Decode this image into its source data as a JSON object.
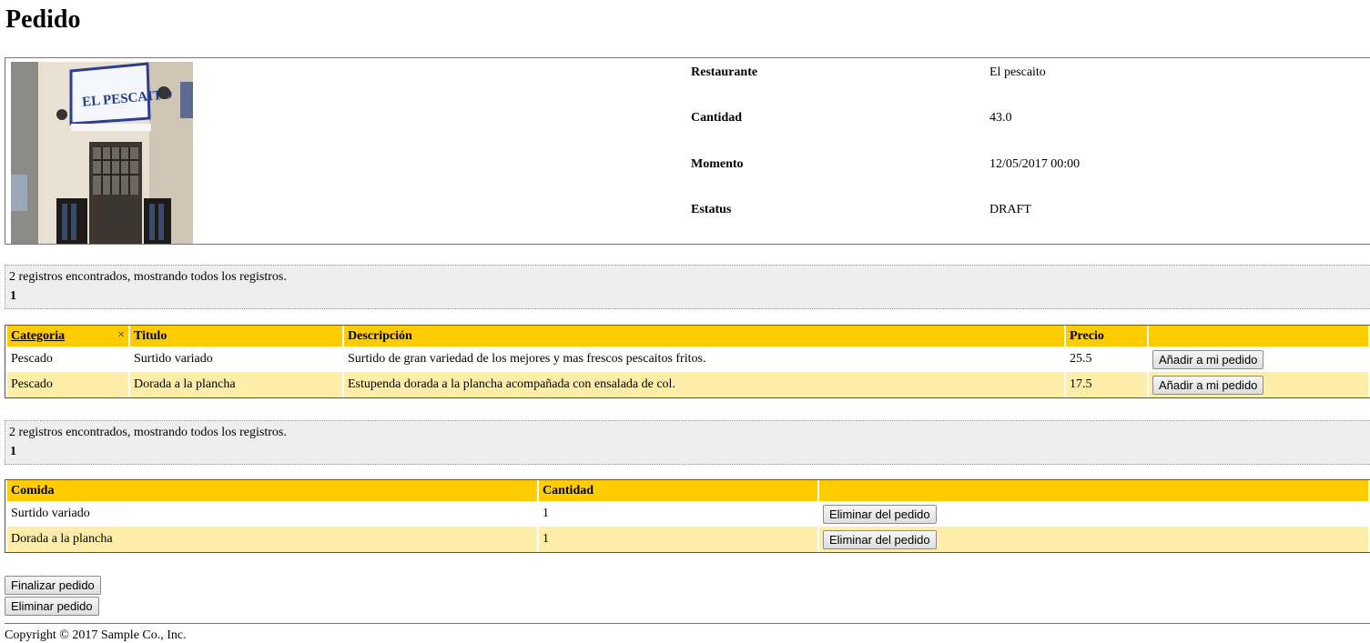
{
  "page": {
    "title": "Pedido"
  },
  "details": {
    "rows": [
      {
        "label": "Restaurante",
        "value": "El pescaito"
      },
      {
        "label": "Cantidad",
        "value": "43.0"
      },
      {
        "label": "Momento",
        "value": "12/05/2017 00:00"
      },
      {
        "label": "Estatus",
        "value": "DRAFT"
      }
    ],
    "sign_text": "EL PESCAITO"
  },
  "menu_list": {
    "info": "2 registros encontrados, mostrando todos los registros.",
    "page": "1",
    "headers": {
      "categoria": "Categoria",
      "titulo": "Titulo",
      "descripcion": "Descripción",
      "precio": "Precio"
    },
    "clear_sort_glyph": "×",
    "rows": [
      {
        "categoria": "Pescado",
        "titulo": "Surtido variado",
        "descripcion": "Surtido de gran variedad de los mejores y mas frescos pescaitos fritos.",
        "precio": "25.5",
        "button": "Añadir a mi pedido"
      },
      {
        "categoria": "Pescado",
        "titulo": "Dorada a la plancha",
        "descripcion": "Estupenda dorada a la plancha acompañada con ensalada de col.",
        "precio": "17.5",
        "button": "Añadir a mi pedido"
      }
    ]
  },
  "order_list": {
    "info": "2 registros encontrados, mostrando todos los registros.",
    "page": "1",
    "headers": {
      "comida": "Comida",
      "cantidad": "Cantidad"
    },
    "rows": [
      {
        "comida": "Surtido variado",
        "cantidad": "1",
        "button": "Eliminar del pedido"
      },
      {
        "comida": "Dorada a la plancha",
        "cantidad": "1",
        "button": "Eliminar del pedido"
      }
    ]
  },
  "actions": {
    "finalize": "Finalizar pedido",
    "delete": "Eliminar pedido"
  },
  "footer": {
    "copyright": "Copyright © 2017 Sample Co., Inc."
  },
  "colors": {
    "header_bg": "#ffcc00",
    "alt_row_bg": "#ffeeaa",
    "info_bg": "#eeeeee"
  }
}
